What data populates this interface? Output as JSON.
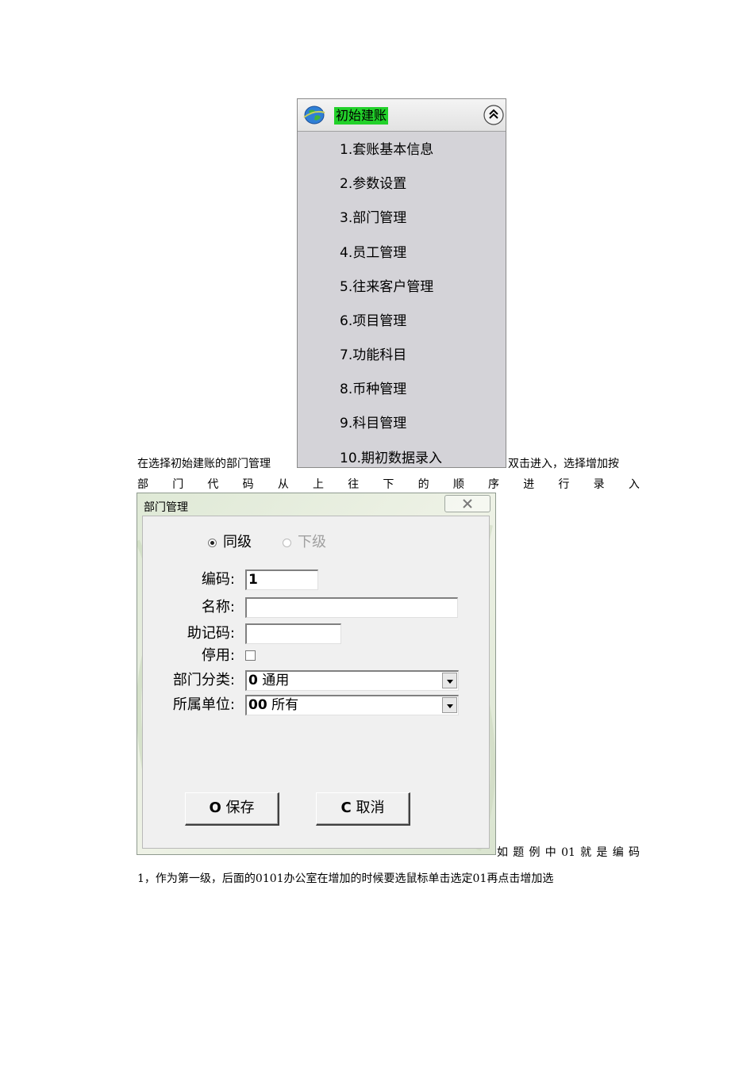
{
  "menu": {
    "title": "初始建账",
    "items": [
      {
        "label": "1.套账基本信息"
      },
      {
        "label": "2.参数设置"
      },
      {
        "label": "3.部门管理"
      },
      {
        "label": "4.员工管理"
      },
      {
        "label": "5.往来客户管理"
      },
      {
        "label": "6.项目管理"
      },
      {
        "label": "7.功能科目"
      },
      {
        "label": "8.币种管理"
      },
      {
        "label": "9.科目管理"
      },
      {
        "label": "10.期初数据录入"
      }
    ]
  },
  "text": {
    "line1_start": "在选择初始建账的部门管理",
    "line1_end": "双击进入，选择增加按",
    "line2_chars": [
      "部",
      "门",
      "代",
      "码",
      "从",
      "上",
      "往",
      "下",
      "的",
      "顺",
      "序",
      "进",
      "行",
      "录",
      "入"
    ],
    "line3_chars": [
      "如",
      "题",
      "例",
      "中",
      "01",
      "就",
      "是",
      "编",
      "码"
    ],
    "line4": "1，作为第一级，后面的0101办公室在增加的时候要选鼠标单击选定01再点击增加选"
  },
  "dialog": {
    "title": "部门管理",
    "radio_same": "同级",
    "radio_lower": "下级",
    "code_label": "编码:",
    "code_value": "1",
    "name_label": "名称:",
    "name_value": "",
    "mnemonic_label": "助记码:",
    "mnemonic_value": "",
    "disabled_label": "停用:",
    "category_label": "部门分类:",
    "category_code": "0",
    "category_text": "通用",
    "unit_label": "所属单位:",
    "unit_code": "00",
    "unit_text": "所有",
    "save_key": "O",
    "save_label": "保存",
    "cancel_key": "C",
    "cancel_label": "取消"
  },
  "colors": {
    "title_highlight": "#22d12a",
    "menu_bg": "#d4d3d8"
  },
  "icons": [
    "globe-icon",
    "collapse-up-icon",
    "close-icon",
    "dropdown-arrow-icon"
  ]
}
